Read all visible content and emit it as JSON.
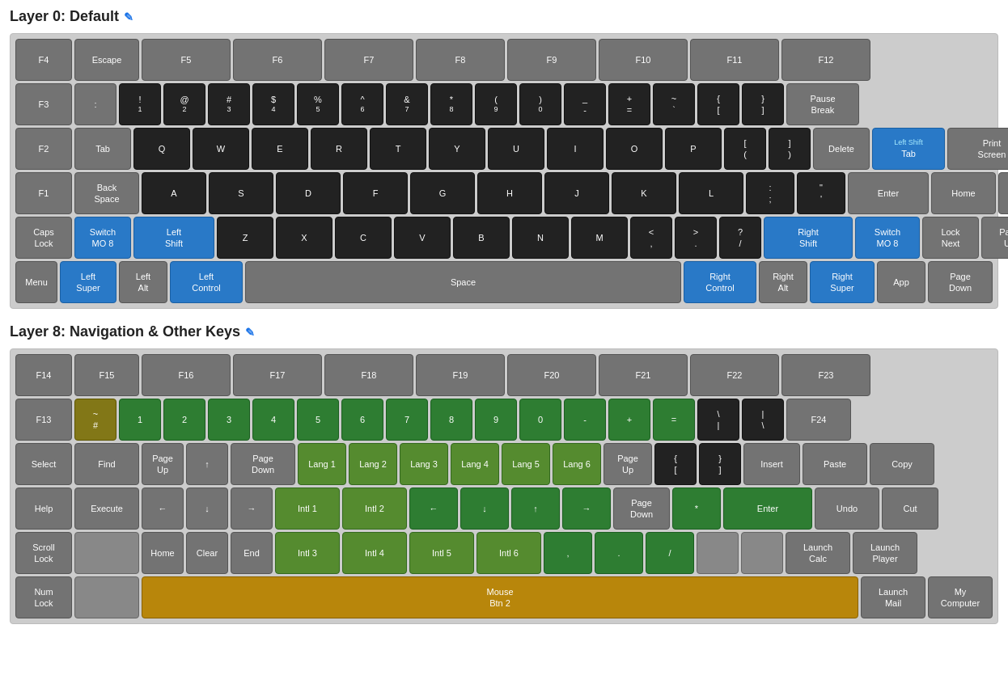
{
  "layer0": {
    "title": "Layer 0: Default",
    "edit_icon": "✎"
  },
  "layer8": {
    "title": "Layer 8: Navigation & Other Keys",
    "edit_icon": "✎"
  },
  "keys": {
    "edit": "✎"
  }
}
